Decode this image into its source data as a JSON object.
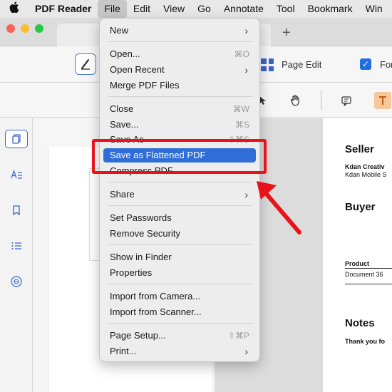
{
  "menubar": {
    "app_name": "PDF Reader",
    "items": [
      "File",
      "Edit",
      "View",
      "Go",
      "Annotate",
      "Tool",
      "Bookmark",
      "Win"
    ]
  },
  "toolbar": {
    "page_edit_label": "Page Edit",
    "form_label": "For"
  },
  "file_menu": {
    "new": "New",
    "open": "Open...",
    "open_shortcut": "⌘O",
    "open_recent": "Open Recent",
    "merge": "Merge PDF Files",
    "close": "Close",
    "close_shortcut": "⌘W",
    "save": "Save...",
    "save_shortcut": "⌘S",
    "save_as": "Save As",
    "save_as_shortcut": "⇧⌘S",
    "save_flattened": "Save as Flattened PDF",
    "compress": "Compress PDF",
    "share": "Share",
    "set_passwords": "Set Passwords",
    "remove_security": "Remove Security",
    "show_in_finder": "Show in Finder",
    "properties": "Properties",
    "import_camera": "Import from Camera...",
    "import_scanner": "Import from Scanner...",
    "page_setup": "Page Setup...",
    "page_setup_shortcut": "⇧⌘P",
    "print": "Print..."
  },
  "document": {
    "seller_heading": "Seller",
    "seller_line1": "Kdan Creativ",
    "seller_line2": "Kdan Mobile S",
    "buyer_heading": "Buyer",
    "product_header": "Product",
    "product_row": "Document 36",
    "notes_heading": "Notes",
    "notes_text": "Thank you fo"
  },
  "colors": {
    "highlight": "#2f6ed8",
    "annotation_red": "#e8121a",
    "accent_blue": "#3a66c4"
  }
}
